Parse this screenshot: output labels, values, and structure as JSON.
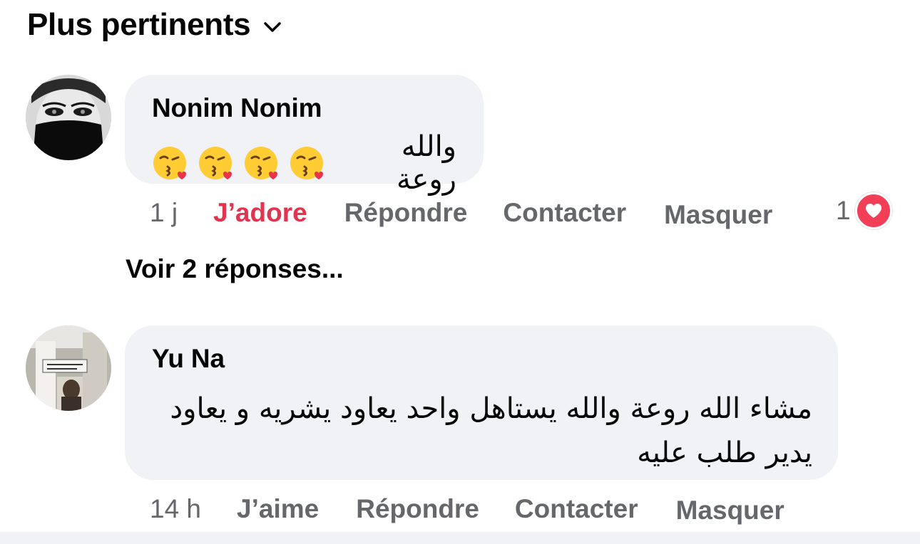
{
  "sort": {
    "label": "Plus pertinents",
    "icon": "chevron-down-icon"
  },
  "comments": [
    {
      "author": "Nonim Nonim",
      "text": "والله روعة",
      "emojis": [
        "face-blowing-kiss-icon",
        "face-blowing-kiss-icon",
        "face-blowing-kiss-icon",
        "face-blowing-kiss-icon"
      ],
      "actions": {
        "time": "1 j",
        "like": "J’adore",
        "reply": "Répondre",
        "contact": "Contacter",
        "hide": "Masquer"
      },
      "reaction_count": "1",
      "reaction_icon": "heart-icon",
      "view_replies": "Voir 2 réponses..."
    },
    {
      "author": "Yu Na",
      "text_line1": "مشاء الله روعة والله يستاهل واحد يعاود يشريه و يعاود",
      "text_line2": "يدير طلب عليه",
      "actions": {
        "time": "14 h",
        "like": "J’aime",
        "reply": "Répondre",
        "contact": "Contacter",
        "hide": "Masquer"
      }
    }
  ],
  "colors": {
    "bubble": "#f0f2f5",
    "secondary_text": "#65676b",
    "love_accent": "#e0344f",
    "heart_badge": "#f33e58"
  }
}
